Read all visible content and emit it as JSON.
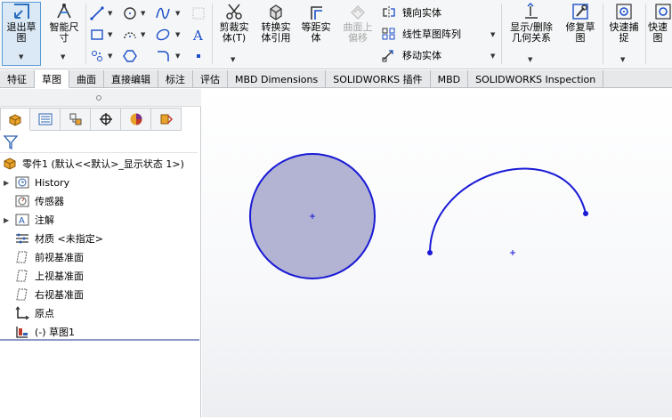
{
  "ribbon": {
    "exit_sketch": {
      "label": "退出草\n图"
    },
    "smart_dimension": {
      "label": "智能尺\n寸"
    },
    "trim": {
      "label": "剪裁实\n体(T)"
    },
    "convert": {
      "label": "转换实\n体引用"
    },
    "offset": {
      "label": "等距实\n体"
    },
    "surface_offset": {
      "label": "曲面上\n偏移"
    },
    "mirror": {
      "label": "镜向实体"
    },
    "linear_pattern": {
      "label": "线性草图阵列"
    },
    "move": {
      "label": "移动实体"
    },
    "display_delete": {
      "label": "显示/删除\n几何关系"
    },
    "repair": {
      "label": "修复草\n图"
    },
    "quick_snap": {
      "label": "快速捕\n捉"
    },
    "quick_view": {
      "label": "快速\n图"
    }
  },
  "tabs": [
    "特征",
    "草图",
    "曲面",
    "直接编辑",
    "标注",
    "评估",
    "MBD Dimensions",
    "SOLIDWORKS 插件",
    "MBD",
    "SOLIDWORKS Inspection"
  ],
  "active_tab": "草图",
  "tree": {
    "root": "零件1 (默认<<默认>_显示状态 1>)",
    "items": [
      {
        "label": "History",
        "expandable": true
      },
      {
        "label": "传感器",
        "expandable": false
      },
      {
        "label": "注解",
        "expandable": true
      },
      {
        "label": "材质 <未指定>",
        "expandable": false
      },
      {
        "label": "前视基准面",
        "expandable": false
      },
      {
        "label": "上视基准面",
        "expandable": false
      },
      {
        "label": "右视基准面",
        "expandable": false
      },
      {
        "label": "原点",
        "expandable": false
      },
      {
        "label": "(-) 草图1",
        "expandable": false
      }
    ]
  },
  "colors": {
    "sketch_blue": "#1a1ad6",
    "circle_fill": "#b3b4d3",
    "accent": "#5b9bd5"
  }
}
